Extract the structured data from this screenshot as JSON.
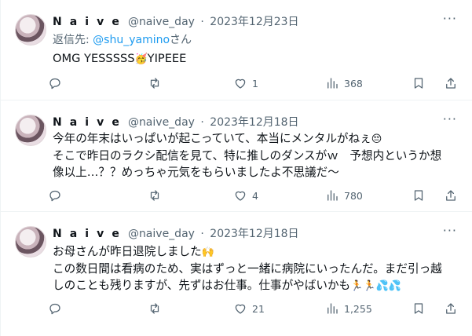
{
  "tweets": [
    {
      "author_name": "N a i v e",
      "handle": "@naive_day",
      "dot": "·",
      "date": "2023年12月23日",
      "reply_prefix": "返信先: ",
      "reply_handle": "@shu_yamino",
      "reply_suffix": "さん",
      "lines": [
        "OMG YESSSSS",
        "YIPEEE"
      ],
      "emoji_1": "🥳",
      "likes": "1",
      "views": "368"
    },
    {
      "author_name": "N a i v e",
      "handle": "@naive_day",
      "dot": "·",
      "date": "2023年12月18日",
      "lines": [
        "今年の年末はいっぱいが起こっていて、本当にメンタルがねぇ",
        "そこで昨日のラクシ配信を見て、特に推しのダンスがｗ　予想内というか想",
        "像以上…？？めっちゃ元気をもらいましたよ不思議だ〜"
      ],
      "emoji_1": "😔",
      "likes": "4",
      "views": "780"
    },
    {
      "author_name": "N a i v e",
      "handle": "@naive_day",
      "dot": "·",
      "date": "2023年12月18日",
      "lines": [
        "お母さんが昨日退院しました",
        "この数日間は看病のため、実はずっと一緒に病院にいったんだ。まだ引っ越",
        "しのことも残りますが、先ずはお仕事。仕事がやばいかも"
      ],
      "emoji_1": "🙌",
      "emoji_2": "🏃🏃💦💦",
      "likes": "21",
      "views": "1,255"
    }
  ],
  "more_label": "···"
}
